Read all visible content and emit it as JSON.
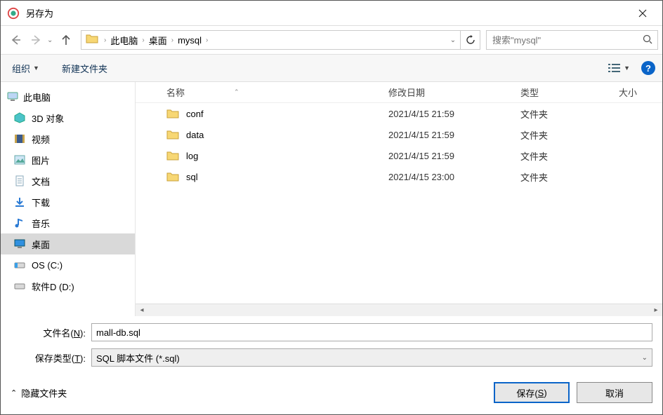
{
  "window": {
    "title": "另存为"
  },
  "nav": {
    "crumbs": [
      "此电脑",
      "桌面",
      "mysql"
    ],
    "search_placeholder": "搜索\"mysql\""
  },
  "toolbar": {
    "organize": "组织",
    "newfolder": "新建文件夹"
  },
  "tree": {
    "root": "此电脑",
    "items": [
      {
        "label": "3D 对象",
        "icon": "cube"
      },
      {
        "label": "视频",
        "icon": "video"
      },
      {
        "label": "图片",
        "icon": "picture"
      },
      {
        "label": "文档",
        "icon": "doc"
      },
      {
        "label": "下载",
        "icon": "download"
      },
      {
        "label": "音乐",
        "icon": "music"
      },
      {
        "label": "桌面",
        "icon": "desktop",
        "selected": true
      },
      {
        "label": "OS (C:)",
        "icon": "drive-c"
      },
      {
        "label": "软件D (D:)",
        "icon": "drive"
      }
    ]
  },
  "columns": {
    "name": "名称",
    "date": "修改日期",
    "type": "类型",
    "size": "大小"
  },
  "files": [
    {
      "name": "conf",
      "date": "2021/4/15 21:59",
      "type": "文件夹"
    },
    {
      "name": "data",
      "date": "2021/4/15 21:59",
      "type": "文件夹"
    },
    {
      "name": "log",
      "date": "2021/4/15 21:59",
      "type": "文件夹"
    },
    {
      "name": "sql",
      "date": "2021/4/15 23:00",
      "type": "文件夹"
    }
  ],
  "form": {
    "filename_label_pre": "文件名(",
    "filename_label_key": "N",
    "filename_label_post": "):",
    "filename_value": "mall-db.sql",
    "type_label_pre": "保存类型(",
    "type_label_key": "T",
    "type_label_post": "):",
    "type_value": "SQL 脚本文件 (*.sql)"
  },
  "bottom": {
    "hide": "隐藏文件夹",
    "save_pre": "保存(",
    "save_key": "S",
    "save_post": ")",
    "cancel": "取消"
  }
}
